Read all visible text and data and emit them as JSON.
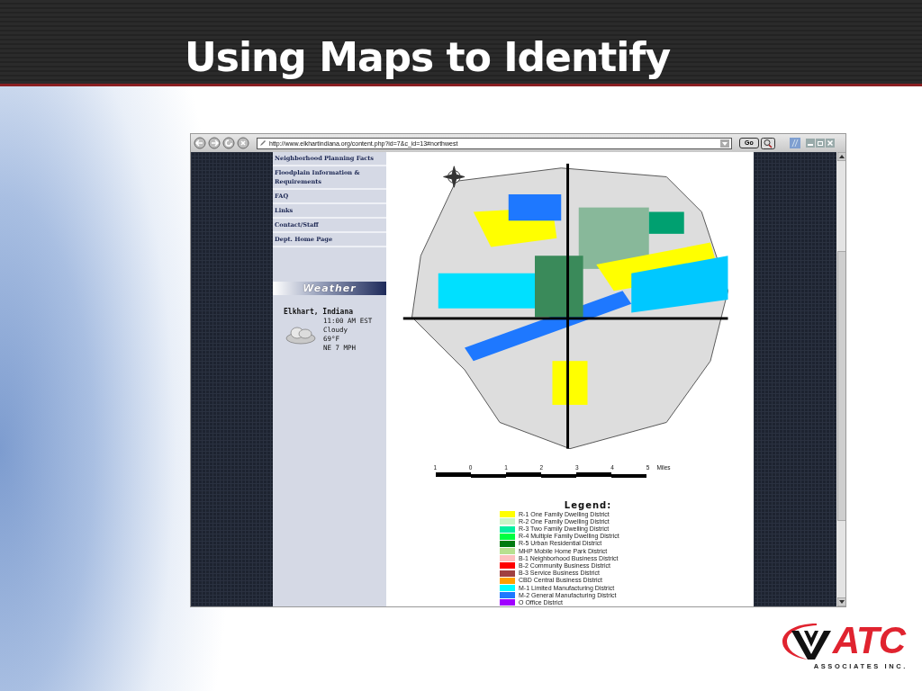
{
  "slide": {
    "title": "Using Maps to Identify"
  },
  "browser": {
    "address": "http://www.elkhartindiana.org/content.php?id=7&c_id=13#northwest",
    "go_label": "Go"
  },
  "nav_links": [
    {
      "label": "Neighborhood Planning Facts"
    },
    {
      "label": "Floodplain Information & Requirements"
    },
    {
      "label": "FAQ"
    },
    {
      "label": "Links"
    },
    {
      "label": "Contact/Staff"
    },
    {
      "label": "Dept. Home Page"
    }
  ],
  "weather": {
    "heading": "Weather",
    "location": "Elkhart, Indiana",
    "time": "11:00 AM EST",
    "condition": "Cloudy",
    "temperature": "69°F",
    "wind": "NE 7 MPH"
  },
  "map": {
    "kind": "picture",
    "scale_labels": [
      "1",
      "0",
      "1",
      "2",
      "3",
      "4",
      "5"
    ],
    "scale_unit": "Miles",
    "legend_title": "Legend:",
    "legend": [
      {
        "label": "R-1 One Family Dwelling District",
        "color": "#ffff00"
      },
      {
        "label": "R-2 One Family Dwelling District",
        "color": "#c8f5c8"
      },
      {
        "label": "R-3 Two Family Dwelling District",
        "color": "#00f0a0"
      },
      {
        "label": "R-4 Multiple Family Dwelling District",
        "color": "#00ff40"
      },
      {
        "label": "R-5 Urban Residential District",
        "color": "#007a10"
      },
      {
        "label": "MHP Mobile Home Park District",
        "color": "#b8e090"
      },
      {
        "label": "B-1 Neighborhood Business District",
        "color": "#ffc0c0"
      },
      {
        "label": "B-2 Community Business District",
        "color": "#ff0000"
      },
      {
        "label": "B-3 Service Business District",
        "color": "#a04040"
      },
      {
        "label": "CBD Central Business District",
        "color": "#ffa000"
      },
      {
        "label": "M-1 Limited Manufacturing District",
        "color": "#00ffff"
      },
      {
        "label": "M-2 General Manufacturing District",
        "color": "#1e78ff"
      },
      {
        "label": "O Office District",
        "color": "#a000ff"
      }
    ]
  },
  "logo": {
    "name": "ATC",
    "tagline": "ASSOCIATES INC."
  }
}
